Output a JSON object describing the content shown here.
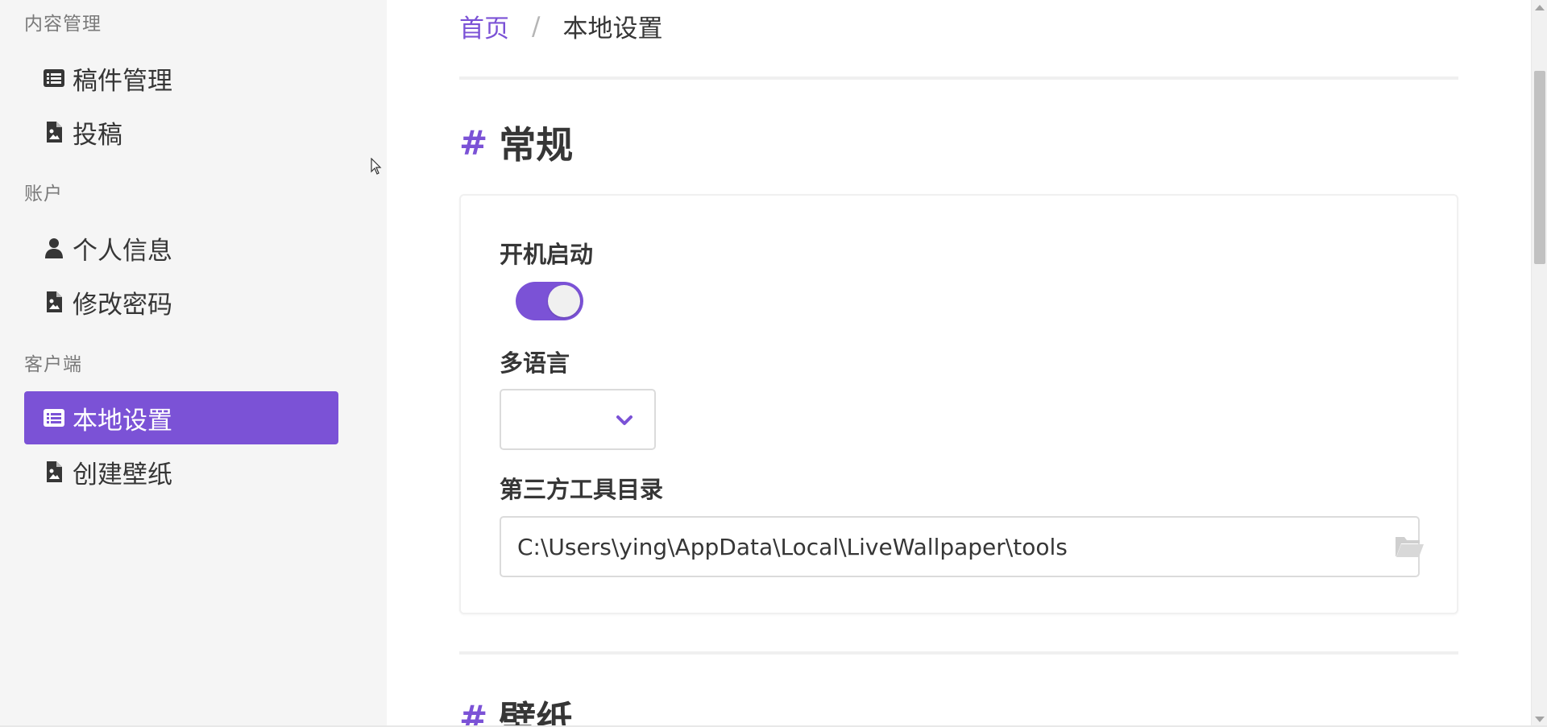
{
  "colors": {
    "accent": "#7b52d6",
    "sidebar_bg": "#f5f5f5",
    "text": "#363636",
    "muted": "#7a7a7a"
  },
  "sidebar": {
    "groups": [
      {
        "label": "内容管理",
        "items": [
          {
            "label": "稿件管理",
            "icon": "list-icon",
            "active": false
          },
          {
            "label": "投稿",
            "icon": "file-image-icon",
            "active": false
          }
        ]
      },
      {
        "label": "账户",
        "items": [
          {
            "label": "个人信息",
            "icon": "user-icon",
            "active": false
          },
          {
            "label": "修改密码",
            "icon": "file-image-icon",
            "active": false
          }
        ]
      },
      {
        "label": "客户端",
        "items": [
          {
            "label": "本地设置",
            "icon": "list-icon",
            "active": true
          },
          {
            "label": "创建壁纸",
            "icon": "file-image-icon",
            "active": false
          }
        ]
      }
    ]
  },
  "breadcrumb": {
    "home": "首页",
    "separator": "/",
    "current": "本地设置"
  },
  "sections": {
    "general": {
      "hash": "#",
      "title": "常规"
    },
    "wallpaper": {
      "hash": "#",
      "title": "壁纸"
    }
  },
  "settings": {
    "autostart": {
      "label": "开机启动",
      "enabled": true
    },
    "language": {
      "label": "多语言",
      "value": ""
    },
    "tools_dir": {
      "label": "第三方工具目录",
      "value": "C:\\Users\\ying\\AppData\\Local\\LiveWallpaper\\tools"
    }
  }
}
